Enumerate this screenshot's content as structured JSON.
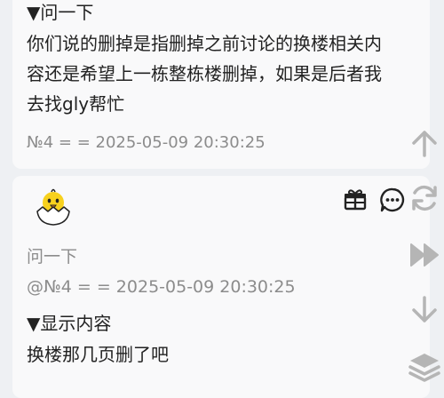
{
  "post4": {
    "toggle_label": "▼问一下",
    "body_lines": [
      "你们说的删掉是指删掉之前讨论的换楼相关内",
      "容还是希望上一栋整栋楼删掉，如果是后者我",
      "去找gly帮忙"
    ],
    "meta": "№4 = = 2025-05-09 20:30:25"
  },
  "reply": {
    "avatar_icon": "chick-in-eggshell-avatar",
    "action_icons": [
      "gift-icon",
      "comment-icon"
    ],
    "quote_title": "问一下",
    "quote_meta": "@№4 = = 2025-05-09 20:30:25",
    "toggle_label": "▼显示内容",
    "body": "换楼那几页删了吧"
  },
  "side_controls": [
    "arrow-up-icon",
    "refresh-icon",
    "fast-forward-icon",
    "arrow-down-icon",
    "layers-icon"
  ],
  "colors": {
    "background": "#eef0f3",
    "card": "#f9f9fa",
    "text": "#222222",
    "meta": "#8c8c8c",
    "icon_gray": "#b5b5b5",
    "chick_yellow": "#f7d11e"
  }
}
